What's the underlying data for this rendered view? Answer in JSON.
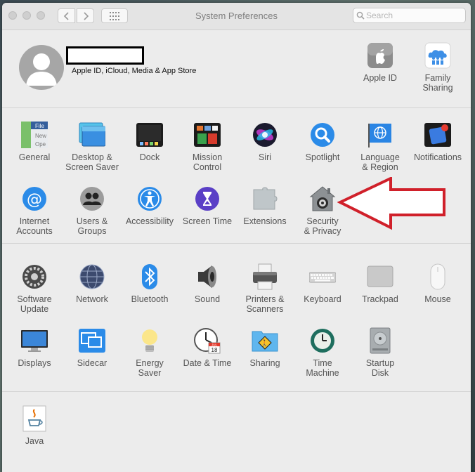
{
  "window": {
    "title": "System Preferences"
  },
  "search": {
    "placeholder": "Search",
    "value": ""
  },
  "account": {
    "subtitle": "Apple ID, iCloud, Media & App Store"
  },
  "top_items": [
    {
      "label": "Apple ID",
      "icon": "apple-id-icon"
    },
    {
      "label": "Family\nSharing",
      "icon": "family-sharing-icon"
    }
  ],
  "section1": [
    {
      "label": "General",
      "icon": "general-icon"
    },
    {
      "label": "Desktop &\nScreen Saver",
      "icon": "desktop-screensaver-icon"
    },
    {
      "label": "Dock",
      "icon": "dock-icon"
    },
    {
      "label": "Mission\nControl",
      "icon": "mission-control-icon"
    },
    {
      "label": "Siri",
      "icon": "siri-icon"
    },
    {
      "label": "Spotlight",
      "icon": "spotlight-icon"
    },
    {
      "label": "Language\n& Region",
      "icon": "language-region-icon"
    },
    {
      "label": "Notifications",
      "icon": "notifications-icon"
    },
    {
      "label": "Internet\nAccounts",
      "icon": "internet-accounts-icon"
    },
    {
      "label": "Users &\nGroups",
      "icon": "users-groups-icon"
    },
    {
      "label": "Accessibility",
      "icon": "accessibility-icon"
    },
    {
      "label": "Screen Time",
      "icon": "screen-time-icon"
    },
    {
      "label": "Extensions",
      "icon": "extensions-icon"
    },
    {
      "label": "Security\n& Privacy",
      "icon": "security-privacy-icon"
    }
  ],
  "section2": [
    {
      "label": "Software\nUpdate",
      "icon": "software-update-icon"
    },
    {
      "label": "Network",
      "icon": "network-icon"
    },
    {
      "label": "Bluetooth",
      "icon": "bluetooth-icon"
    },
    {
      "label": "Sound",
      "icon": "sound-icon"
    },
    {
      "label": "Printers &\nScanners",
      "icon": "printers-scanners-icon"
    },
    {
      "label": "Keyboard",
      "icon": "keyboard-icon"
    },
    {
      "label": "Trackpad",
      "icon": "trackpad-icon"
    },
    {
      "label": "Mouse",
      "icon": "mouse-icon"
    },
    {
      "label": "Displays",
      "icon": "displays-icon"
    },
    {
      "label": "Sidecar",
      "icon": "sidecar-icon"
    },
    {
      "label": "Energy\nSaver",
      "icon": "energy-saver-icon"
    },
    {
      "label": "Date & Time",
      "icon": "date-time-icon"
    },
    {
      "label": "Sharing",
      "icon": "sharing-icon"
    },
    {
      "label": "Time\nMachine",
      "icon": "time-machine-icon"
    },
    {
      "label": "Startup\nDisk",
      "icon": "startup-disk-icon"
    }
  ],
  "section3": [
    {
      "label": "Java",
      "icon": "java-icon"
    }
  ],
  "icon_text": {
    "general_file": "File",
    "general_new": "New",
    "general_ope": "Ope",
    "calendar_month": "JUL",
    "calendar_day": "18"
  },
  "colors": {
    "annotation_arrow": "#d0202a",
    "window_bg": "#ececec",
    "label_text": "#545454"
  }
}
